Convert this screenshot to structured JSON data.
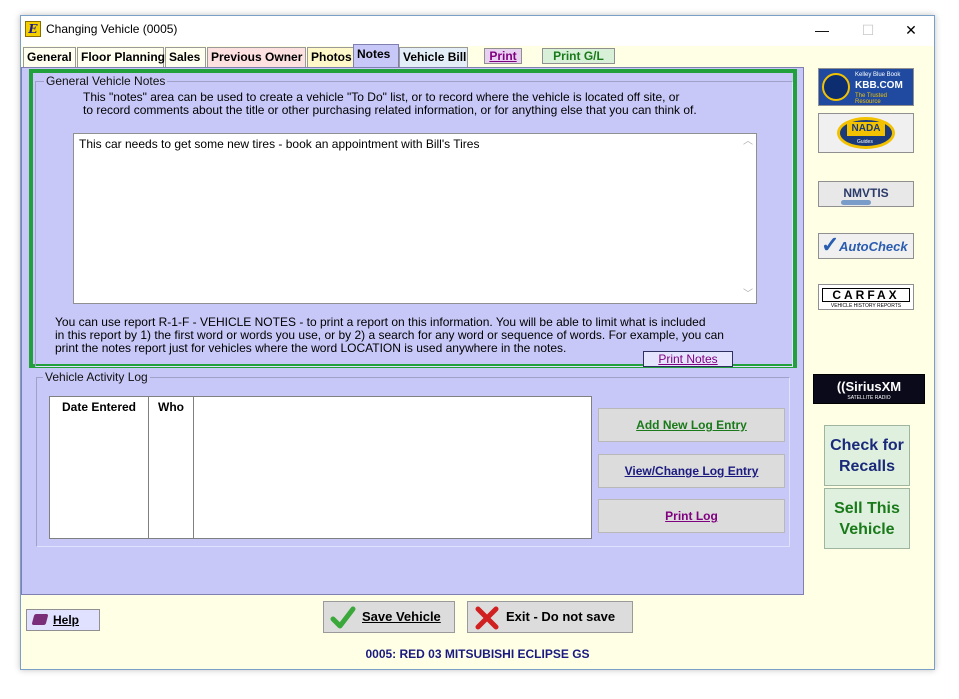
{
  "window": {
    "title": "Changing Vehicle  (0005)",
    "app_icon": "E",
    "controls": {
      "minimize": "—",
      "maximize": "☐",
      "close": "✕"
    }
  },
  "tabs": {
    "general": "General",
    "floor_planning": "Floor Planning",
    "sales": "Sales",
    "previous_owner": "Previous Owner",
    "photos": "Photos",
    "notes": "Notes",
    "vehicle_bill": "Vehicle Bill",
    "print": "Print",
    "print_gl": "Print G/L"
  },
  "general_notes": {
    "group_title": "General Vehicle Notes",
    "instructions": [
      "This \"notes\" area can be used to create a vehicle \"To Do\" list, or to record where the vehicle is located off site, or",
      "to record comments about the title or other purchasing related information, or for anything else that you can think of."
    ],
    "notes_value": "This car needs to get some new tires - book an appointment with Bill's Tires",
    "report_text": [
      "You can use report R-1-F - VEHICLE NOTES - to print a report on this information.  You will be able to limit what is included",
      "in this report by 1) the first word or words you use, or by 2) a search for any word or sequence of words.  For example, you can",
      "print the notes report just for vehicles where the word LOCATION is used anywhere in the notes."
    ],
    "print_notes_label": "Print Notes"
  },
  "activity_log": {
    "group_title": "Vehicle Activity Log",
    "columns": [
      "Date Entered",
      "Who"
    ],
    "buttons": {
      "add": "Add New Log Entry",
      "view_change": "View/Change Log Entry",
      "print": "Print Log"
    }
  },
  "side_panel": {
    "kbb_line1": "Kelley Blue Book",
    "kbb_line2": "KBB.COM",
    "kbb_line3": "The Trusted Resource",
    "nada": "NADA",
    "nada_sub": "Guides",
    "nmvtis": "NMVTIS",
    "autocheck": "AutoCheck",
    "carfax": "CARFAX",
    "carfax_sub": "VEHICLE HISTORY REPORTS",
    "siriusxm": "((SiriusXM",
    "siriusxm_sub": "SATELLITE RADIO",
    "check_recalls": "Check for Recalls",
    "sell_vehicle": "Sell This Vehicle"
  },
  "footer": {
    "help": "Help",
    "save": "Save Vehicle",
    "exit": "Exit - Do not save",
    "status": "0005: RED 03 MITSUBISHI ECLIPSE GS"
  },
  "colors": {
    "panel_bg": "#c8c8f8",
    "window_bg": "#ffffe6",
    "highlight_border": "#22a03c"
  }
}
